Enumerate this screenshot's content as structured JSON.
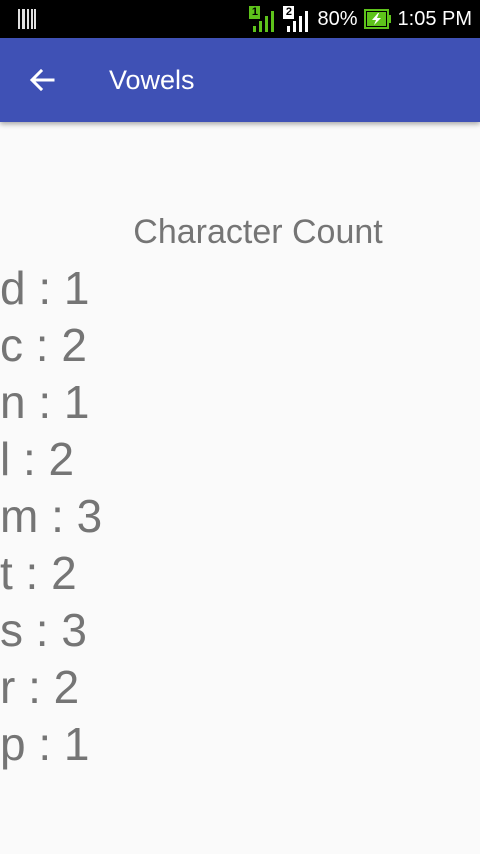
{
  "status_bar": {
    "sim1_label": "1",
    "sim2_label": "2",
    "battery": "80%",
    "time": "1:05 PM",
    "icons": [
      "barcode-icon",
      "signal-icon",
      "signal-icon",
      "battery-charging-icon"
    ],
    "sim1_color": "#5ec31b",
    "battery_color": "#5ec31b"
  },
  "app_bar": {
    "title": "Vowels",
    "back_icon": "arrow-left-icon",
    "color": "#3f51b5"
  },
  "content": {
    "heading": "Character Count",
    "items": [
      "d : 1",
      "c : 2",
      "n : 1",
      "l : 2",
      "m : 3",
      "t : 2",
      "s : 3",
      "r : 2",
      "p : 1"
    ]
  }
}
